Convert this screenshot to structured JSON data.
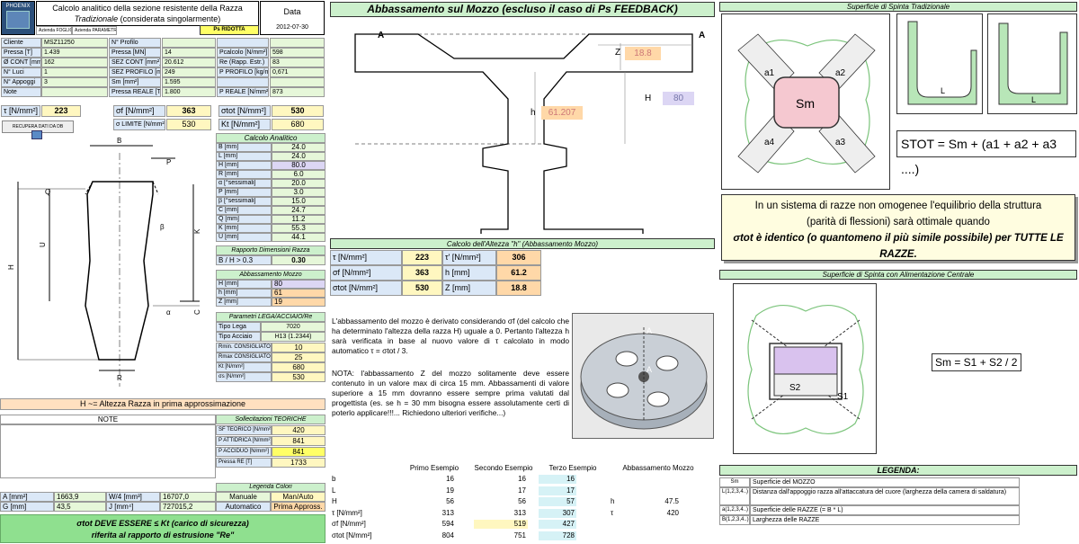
{
  "header": {
    "logo_text": "PHOENIX",
    "title_line1": "Calcolo analitico della sezione resistente della Razza",
    "title_line2_em": "Tradizionale",
    "title_line2_rest": "(considerata singolarmente)",
    "data_label": "Data",
    "date": "2012-07-30",
    "sub1": "Azienda FOGLIO",
    "sub2": "Azienda PARAMETRI",
    "ps_label": "Ps RIDOTTA"
  },
  "info": {
    "rows": [
      [
        "Cliente",
        "MSZ11250",
        "N° Profilo",
        "",
        "",
        ""
      ],
      [
        "Pressa [T]",
        "1.439",
        "Pressa [MN]",
        "14",
        "Pcalcolo [N/mm²]",
        "598"
      ],
      [
        "Ø CONT [mm]",
        "162",
        "SEZ CONT [mm²]",
        "20.612",
        "Re (Rapp. Estr.)",
        "83"
      ],
      [
        "N° Luci",
        "1",
        "SEZ PROFILO [mm²]",
        "249",
        "P PROFILO [kg/ml]",
        "0,671"
      ],
      [
        "N° Appoggi",
        "3",
        "Sm [mm²]",
        "1.595",
        "",
        ""
      ],
      [
        "Note",
        "",
        "Pressa REALE [T]",
        "1.800",
        "P REALE [N/mm²]",
        "873"
      ]
    ]
  },
  "stress": {
    "tau_label": "τ [N/mm²]",
    "tau": "223",
    "sf_label": "σf [N/mm²]",
    "sf": "363",
    "stot_label": "σtot [N/mm²]",
    "stot": "530",
    "slim_label": "σ LIMITE [N/mm²]",
    "slim": "530",
    "kt_label": "Kt [N/mm²]",
    "kt": "680",
    "recupera": "RECUPERA DATI DA DB"
  },
  "calcolo_analitico": {
    "title": "Calcolo Analitico",
    "rows": [
      [
        "B [mm]",
        "24.0"
      ],
      [
        "L [mm]",
        "24.0"
      ],
      [
        "H [mm]",
        "80.0"
      ],
      [
        "R [mm]",
        "6.0"
      ],
      [
        "α [°sessimali]",
        "20.0"
      ],
      [
        "P [mm]",
        "3.0"
      ],
      [
        "β [°sessimali]",
        "15.0"
      ],
      [
        "C [mm]",
        "24.7"
      ],
      [
        "Q [mm]",
        "11.2"
      ],
      [
        "K [mm]",
        "55.3"
      ],
      [
        "U [mm]",
        "44.1"
      ]
    ]
  },
  "rapporto": {
    "title": "Rapporto Dimensioni Razza",
    "label": "B / H > 0.3",
    "value": "0.30"
  },
  "abbassamento_small": {
    "title": "Abbassamento Mozzo",
    "rows": [
      [
        "H [mm]",
        "80"
      ],
      [
        "h [mm]",
        "61"
      ],
      [
        "Z [mm]",
        "19"
      ]
    ]
  },
  "parametri": {
    "title": "Parametri LEGA/ACCIAIO/Re",
    "lega_label": "Tipo Lega",
    "lega": "7020",
    "acciaio_label": "Tipo Acciaio",
    "acciaio": "H13 (1.2344)",
    "rows": [
      [
        "Rmin. CONSIGLIATO",
        "10"
      ],
      [
        "Rmax CONSIGLIATO",
        "25"
      ],
      [
        "Kt [N/mm²]",
        "680"
      ],
      [
        "σs [N/mm²]",
        "530"
      ]
    ]
  },
  "h_note": "H ~= Altezza Razza in prima approssimazione",
  "note_title": "NOTE",
  "sollecitazioni": {
    "title": "Sollecitazioni TEORICHE",
    "rows": [
      [
        "SF TEORICO [N/mm²]",
        "420"
      ],
      [
        "P ATTIDRICA [N/mm²]",
        "841"
      ],
      [
        "P ACCIDUO [N/mm²]",
        "841"
      ],
      [
        "Pressa RE [T]",
        "1733"
      ]
    ]
  },
  "geo": {
    "rows": [
      [
        "A [mm²]",
        "1663,9",
        "W/4 [mm³]",
        "16707,0"
      ],
      [
        "G [mm]",
        "43,5",
        "J [mm⁴]",
        "727015,2"
      ]
    ]
  },
  "legenda_colori": {
    "title": "Legenda Colori",
    "items": [
      "Manuale",
      "Man/Auto",
      "Automatico",
      "Prima Appross."
    ]
  },
  "footer_note1": "σtot DEVE ESSERE ≤ Kt (carico di sicurezza)",
  "footer_note2": "riferita al rapporto di estrusione \"Re\"",
  "mid": {
    "title": "Abbassamento sul Mozzo (escluso il caso di Ps FEEDBACK)",
    "label_a": "A",
    "z_label": "Z",
    "z_val": "18.8",
    "h_label": "h",
    "h_val": "61.207",
    "H_label": "H",
    "H_val": "80",
    "calc_title": "Calcolo dell'Altezza \"h\" (Abbassamento Mozzo)",
    "calc_rows": [
      [
        "τ [N/mm²]",
        "223",
        "τ' [N/mm²]",
        "306"
      ],
      [
        "σf [N/mm²]",
        "363",
        "h [mm]",
        "61.2"
      ],
      [
        "σtot [N/mm²]",
        "530",
        "Z [mm]",
        "18.8"
      ]
    ],
    "para1": "L'abbassamento del mozzo è derivato considerando σf (del calcolo che ha determinato l'altezza della razza H) uguale a 0. Pertanto l'altezza h sarà verificata in base al nuovo valore di τ calcolato in modo automatico τ = σtot / 3.",
    "para2": "NOTA: l'abbassamento Z del mozzo solitamente deve essere contenuto in un valore max di circa 15 mm. Abbassamenti di valore superiore a 15 mm dovranno essere sempre prima valutati dal progettista (es. se h = 30 mm bisogna essere assolutamente certi di poterlo applicare!!!... Richiedono ulteriori verifiche...)"
  },
  "esempi": {
    "headers": [
      "",
      "Primo Esempio",
      "Secondo Esempio",
      "Terzo Esempio",
      "Abbassamento Mozzo"
    ],
    "rows": [
      [
        "b",
        "16",
        "16",
        "16",
        "",
        ""
      ],
      [
        "L",
        "19",
        "17",
        "17",
        "",
        ""
      ],
      [
        "H",
        "56",
        "56",
        "57",
        "h",
        "47.5"
      ],
      [
        "τ [N/mm²]",
        "313",
        "313",
        "307",
        "τ",
        "420"
      ],
      [
        "σf [N/mm²]",
        "594",
        "519",
        "427",
        "",
        ""
      ],
      [
        "σtot [N/mm²]",
        "804",
        "751",
        "728",
        "",
        ""
      ]
    ]
  },
  "right": {
    "title1": "Superficie di Spinta Tradizionale",
    "sm": "Sm",
    "a_labels": [
      "a1",
      "a2",
      "a3",
      "a4"
    ],
    "stot_formula": "STOT = Sm + (a1 + a2 + a3 ....)",
    "L_label": "L",
    "box_text1": "In un sistema di razze non omogenee l'equilibrio della struttura",
    "box_text2": "(parità di flessioni) sarà ottimale quando",
    "box_text3": "σtot è identico (o quantomeno il più simile possibile) per TUTTE LE RAZZE.",
    "title2": "Superficie di Spinta con Alimentazione Centrale",
    "s1": "S1",
    "s2": "S2",
    "sm_formula": "Sm = S1 + S2 / 2",
    "legenda_title": "LEGENDA:",
    "legenda": [
      [
        "Sm",
        "Superficie del MOZZO"
      ],
      [
        "L(1,2,3,4..)",
        "Distanza dall'appoggio razza all'attaccatura del cuore (larghezza della camera di saldatura)"
      ],
      [
        "a(1,2,3,4..)",
        "Superficie delle RAZZE (= B * L)"
      ],
      [
        "B(1,2,3,4..)",
        "Larghezza delle RAZZE"
      ]
    ]
  }
}
